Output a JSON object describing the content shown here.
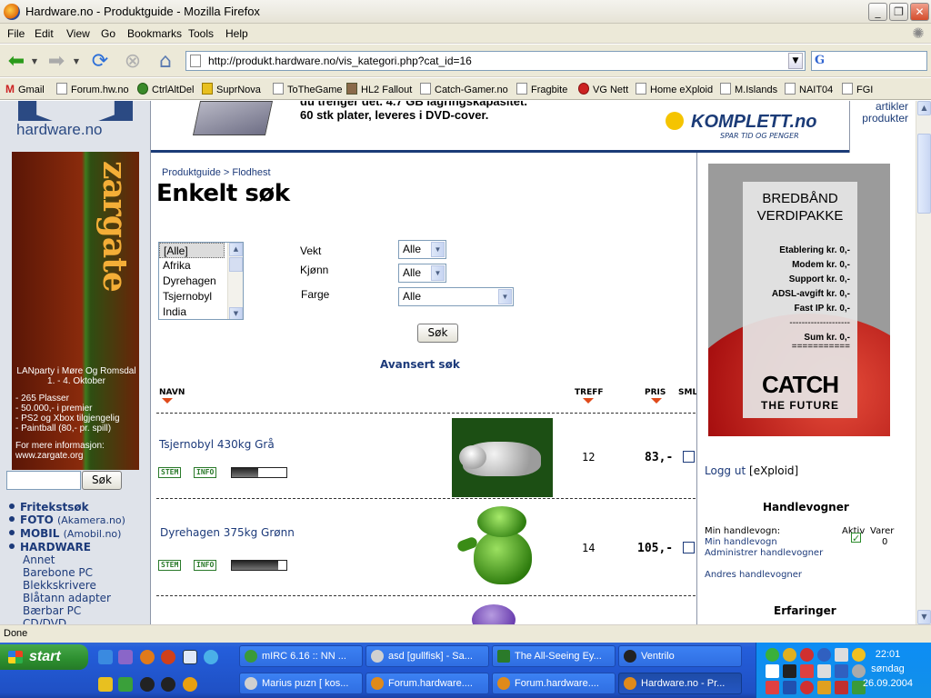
{
  "window": {
    "title": "Hardware.no - Produktguide - Mozilla Firefox",
    "buttons": [
      "_",
      "❐",
      "✕"
    ]
  },
  "menu": [
    "File",
    "Edit",
    "View",
    "Go",
    "Bookmarks",
    "Tools",
    "Help"
  ],
  "nav": {
    "url": "http://produkt.hardware.no/vis_kategori.php?cat_id=16",
    "search_engine": "G"
  },
  "bookmarks": [
    {
      "label": "Gmail",
      "icon": "gmail-icon"
    },
    {
      "label": "Forum.hw.no",
      "icon": "page-icon"
    },
    {
      "label": "CtrlAltDel",
      "icon": "ctrlaltdel-icon"
    },
    {
      "label": "SuprNova",
      "icon": "suprnova-icon"
    },
    {
      "label": "ToTheGame",
      "icon": "page-icon"
    },
    {
      "label": "HL2 Fallout",
      "icon": "hl2-icon"
    },
    {
      "label": "Catch-Gamer.no",
      "icon": "page-icon"
    },
    {
      "label": "Fragbite",
      "icon": "page-icon"
    },
    {
      "label": "VG Nett",
      "icon": "vg-icon"
    },
    {
      "label": "Home eXploid",
      "icon": "page-icon"
    },
    {
      "label": "M.Islands",
      "icon": "page-icon"
    },
    {
      "label": "NAIT04",
      "icon": "page-icon"
    },
    {
      "label": "FGI",
      "icon": "page-icon"
    }
  ],
  "site": {
    "logo": "hardware.no",
    "banner": {
      "line1": "du trenger det. 4.7 GB lagringskapasitet.",
      "line2": "60 stk plater, leveres i DVD-cover.",
      "brand": "KOMPLETT.no",
      "slogan": "SPAR TID OG PENGER"
    },
    "right_banner": [
      "artikler",
      "produkter"
    ],
    "zargate": {
      "logo": "zargate",
      "lines": [
        "LANparty i Møre Og Romsdal",
        "1. - 4. Oktober",
        "",
        "- 265 Plasser",
        "- 50.000,- i premier",
        "- PS2 og Xbox tilgjengelig",
        "- Paintball (80,- pr. spill)",
        "",
        "For mere informasjon:",
        "www.zargate.org"
      ]
    },
    "left_search": {
      "value": "",
      "button": "Søk"
    },
    "left_nav": [
      {
        "label": "Fritekstsøk",
        "note": ""
      },
      {
        "label": "FOTO",
        "note": "(Akamera.no)"
      },
      {
        "label": "MOBIL",
        "note": "(Amobil.no)"
      },
      {
        "label": "HARDWARE",
        "note": ""
      }
    ],
    "left_sub": [
      "Annet",
      "Barebone PC",
      "Blekkskrivere",
      "Blåtann adapter",
      "Bærbar PC",
      "CD/DVD"
    ]
  },
  "main": {
    "breadcrumb": [
      "Produktguide",
      ">",
      "Flodhest"
    ],
    "title": "Enkelt søk",
    "listbox": [
      "[Alle]",
      "Afrika",
      "Dyrehagen",
      "Tsjernobyl",
      "India"
    ],
    "filters": {
      "vekt": {
        "label": "Vekt",
        "value": "Alle"
      },
      "kjonn": {
        "label": "Kjønn",
        "value": "Alle"
      },
      "farge": {
        "label": "Farge",
        "value": "Alle"
      }
    },
    "search_button": "Søk",
    "advanced": "Avansert søk",
    "columns": {
      "navn": "NAVN",
      "treff": "TREFF",
      "pris": "PRIS",
      "sml": "SML"
    },
    "products": [
      {
        "name": "Tsjernobyl 430kg Grå",
        "tag1": "STEM",
        "tag2": "INFO",
        "rating": 0.48,
        "treff": "12",
        "pris": "83,-"
      },
      {
        "name": "Dyrehagen 375kg Grønn",
        "tag1": "STEM",
        "tag2": "INFO",
        "rating": 0.85,
        "treff": "14",
        "pris": "105,-"
      }
    ]
  },
  "right": {
    "ad": {
      "title": [
        "BREDBÅND",
        "VERDIPAKKE"
      ],
      "lines": [
        "Etablering kr. 0,-",
        "Modem kr. 0,-",
        "Support kr. 0,-",
        "ADSL-avgift kr. 0,-",
        "Fast IP kr. 0,-",
        "--------------------",
        "Sum   kr. 0,-",
        "==========="
      ],
      "brand": "CATCH",
      "tagline": "THE FUTURE"
    },
    "logout": "Logg ut",
    "user": "[eXploid]",
    "carts_heading": "Handlevogner",
    "cart_label": "Min handlevogn:",
    "cart_col_active": "Aktiv",
    "cart_col_items": "Varer",
    "cart_link": "Min handlevogn",
    "cart_items": "0",
    "admin_link": "Administrer handlevogner",
    "others_link": "Andres handlevogner",
    "experiences_heading": "Erfaringer"
  },
  "status": "Done",
  "taskbar": {
    "start": "start",
    "tasks_row1": [
      "mIRC 6.16 :: NN ...",
      "asd [gullfisk] - Sa...",
      "The All-Seeing Ey...",
      "Ventrilo"
    ],
    "tasks_row2": [
      "Marius puzn [ kos...",
      "Forum.hardware....",
      "Forum.hardware....",
      "Hardware.no - Pr..."
    ],
    "clock": {
      "time": "22:01",
      "day": "søndag",
      "date": "26.09.2004"
    }
  }
}
